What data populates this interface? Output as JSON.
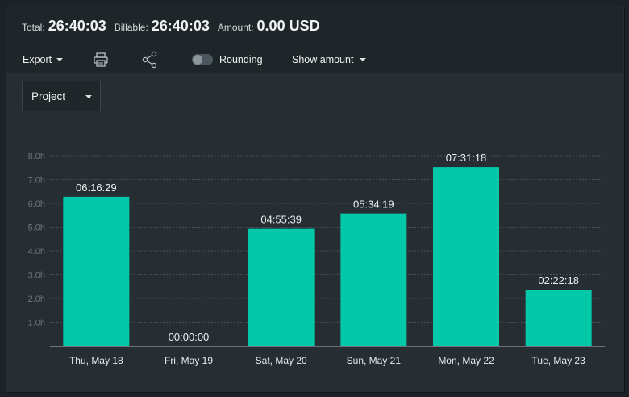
{
  "summary": {
    "total_label": "Total:",
    "total_value": "26:40:03",
    "billable_label": "Billable:",
    "billable_value": "26:40:03",
    "amount_label": "Amount:",
    "amount_value": "0.00 USD"
  },
  "toolbar": {
    "export_label": "Export",
    "print_icon": "printer-icon",
    "share_icon": "share-icon",
    "rounding_label": "Rounding",
    "rounding_on": false,
    "show_amount_label": "Show amount"
  },
  "group_by": {
    "selected": "Project"
  },
  "colors": {
    "bar": "#03c9a9",
    "background": "#262e33",
    "header": "#1f262a"
  },
  "chart_data": {
    "type": "bar",
    "categories": [
      "Thu, May 18",
      "Fri, May 19",
      "Sat, May 20",
      "Sun, May 21",
      "Mon, May 22",
      "Tue, May 23"
    ],
    "values": [
      6.2747,
      0,
      4.9275,
      5.5719,
      7.5217,
      2.3717
    ],
    "data_labels": [
      "06:16:29",
      "00:00:00",
      "04:55:39",
      "05:34:19",
      "07:31:18",
      "02:22:18"
    ],
    "y_ticks": [
      "1.0h",
      "2.0h",
      "3.0h",
      "4.0h",
      "5.0h",
      "6.0h",
      "7.0h",
      "8.0h"
    ],
    "ylim": [
      0,
      8
    ],
    "grid": true
  }
}
